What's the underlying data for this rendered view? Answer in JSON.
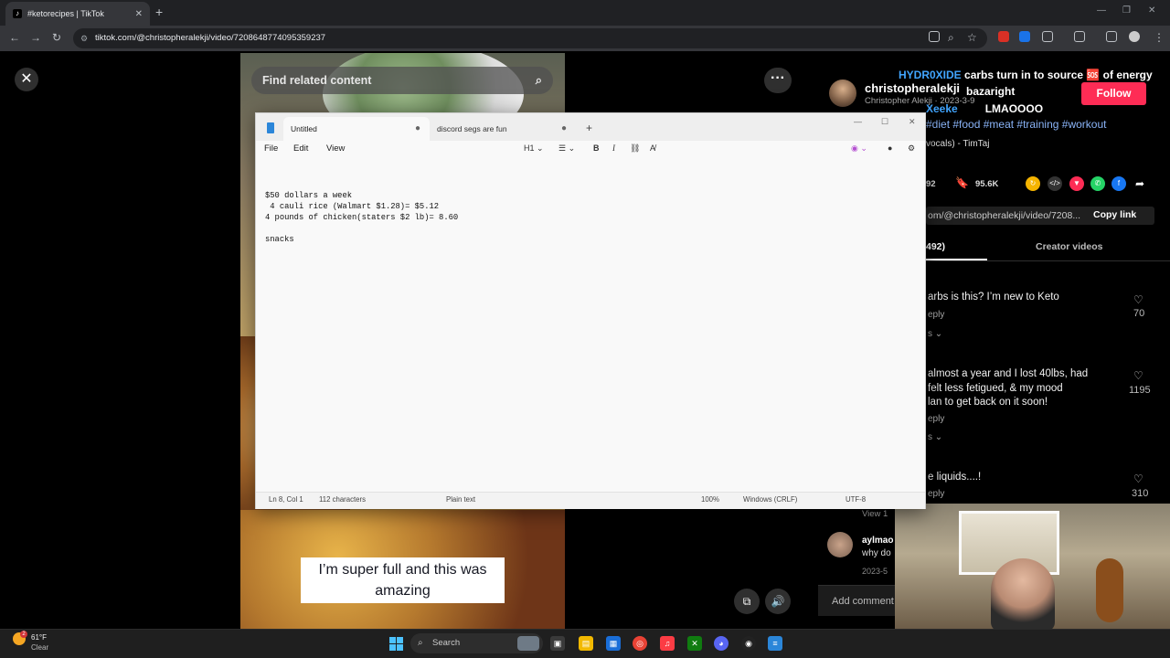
{
  "browser": {
    "tab_title": "#ketorecipes | TikTok",
    "url": "tiktok.com/@christopheralekji/video/7208648774095359237",
    "new_tab": "+",
    "tab_close": "✕"
  },
  "tiktok": {
    "search_placeholder": "Find related content",
    "caption_line1": "I’m super full and this was",
    "caption_line2": "amazing",
    "username": "christopheralekji",
    "user_fullname_date": "Christopher Alekji · 2023-3-9",
    "follow_label": "Follow",
    "hashtags": "#diet #food #meat #training #workout",
    "music": "vocals) - TimTaj",
    "count_partial": "92",
    "saves": "95.6K",
    "link": "om/@christopheralekji/video/7208...",
    "copy_link": "Copy link",
    "tab_comments": "492)",
    "tab_creator": "Creator videos",
    "comments": [
      {
        "text_lines": [
          "arbs is this? I’m new to Keto"
        ],
        "reply": "eply",
        "more": "s ⌄",
        "likes": "70"
      },
      {
        "text_lines": [
          "almost a year and I lost 40lbs, had",
          " felt less fetigued, & my mood",
          "lan to get back on it soon!"
        ],
        "reply": "eply",
        "more": "s ⌄",
        "likes": "1195"
      },
      {
        "text_lines": [
          "e liquids....!"
        ],
        "reply": "eply",
        "more": "",
        "likes": "310"
      }
    ],
    "comment4_name": "aylmao",
    "comment4_text": "why do",
    "comment4_date": "2023-5",
    "view_one": "View 1",
    "add_comment": "Add comment"
  },
  "chat": {
    "msg1_user": "HYDR0XIDE",
    "msg1_text": "carbs turn in to source 🆘 of energy",
    "msg2_text": "bazaright",
    "msg3_user": "Xeeke",
    "msg3_text": "LMAOOOO"
  },
  "notepad": {
    "tab1": "Untitled",
    "tab2": "discord segs are fun",
    "menu": [
      "File",
      "Edit",
      "View"
    ],
    "heading_tool": "H1",
    "text": "$50 dollars a week\n 4 cauli rice (Walmart $1.28)= $5.12\n4 pounds of chicken(staters $2 lb)= 8.60\n\nsnacks",
    "status": {
      "position": "Ln 8, Col 1",
      "chars": "112 characters",
      "type": "Plain text",
      "zoom": "100%",
      "eol": "Windows (CRLF)",
      "encoding": "UTF-8"
    }
  },
  "taskbar": {
    "weather_temp": "61°F",
    "weather_desc": "Clear",
    "weather_badge": "2",
    "search": "Search"
  },
  "colors": {
    "follow": "#fe2c55",
    "chat_user": "#41a5ff",
    "accent_start": "#4cc2ff"
  }
}
